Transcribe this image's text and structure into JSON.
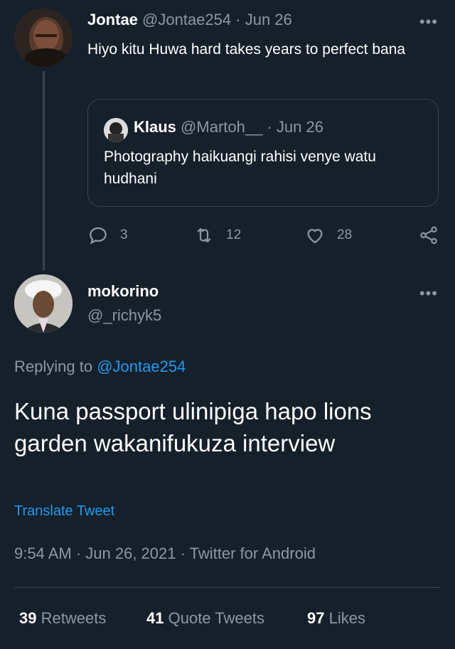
{
  "reply_parent": {
    "display_name": "Jontae",
    "handle": "@Jontae254",
    "separator": "·",
    "date": "Jun 26",
    "text": "Hiyo kitu Huwa hard takes years to perfect bana",
    "more": "•••",
    "quote": {
      "display_name": "Klaus",
      "handle": "@Martoh__",
      "separator": "·",
      "date": "Jun 26",
      "text": "Photography haikuangi rahisi venye watu hudhani"
    },
    "actions": {
      "replies": "3",
      "retweets": "12",
      "likes": "28"
    }
  },
  "main_tweet": {
    "display_name": "mokorino",
    "handle": "@_richyk5",
    "more": "•••",
    "replying_prefix": "Replying to",
    "replying_to": "@Jontae254",
    "text": "Kuna passport ulinipiga hapo lions garden wakanifukuza interview",
    "translate_label": "Translate Tweet",
    "meta": "9:54 AM · Jun 26, 2021 · Twitter for Android"
  },
  "stats": {
    "retweets_count": "39",
    "retweets_label": "Retweets",
    "quotes_count": "41",
    "quotes_label": "Quote Tweets",
    "likes_count": "97",
    "likes_label": "Likes"
  },
  "colors": {
    "background": "#15202b",
    "muted": "#8b98a5",
    "link": "#1d9bf0",
    "border": "#38444d"
  },
  "icons": [
    "reply-icon",
    "retweet-icon",
    "like-icon",
    "share-icon",
    "more-icon"
  ]
}
